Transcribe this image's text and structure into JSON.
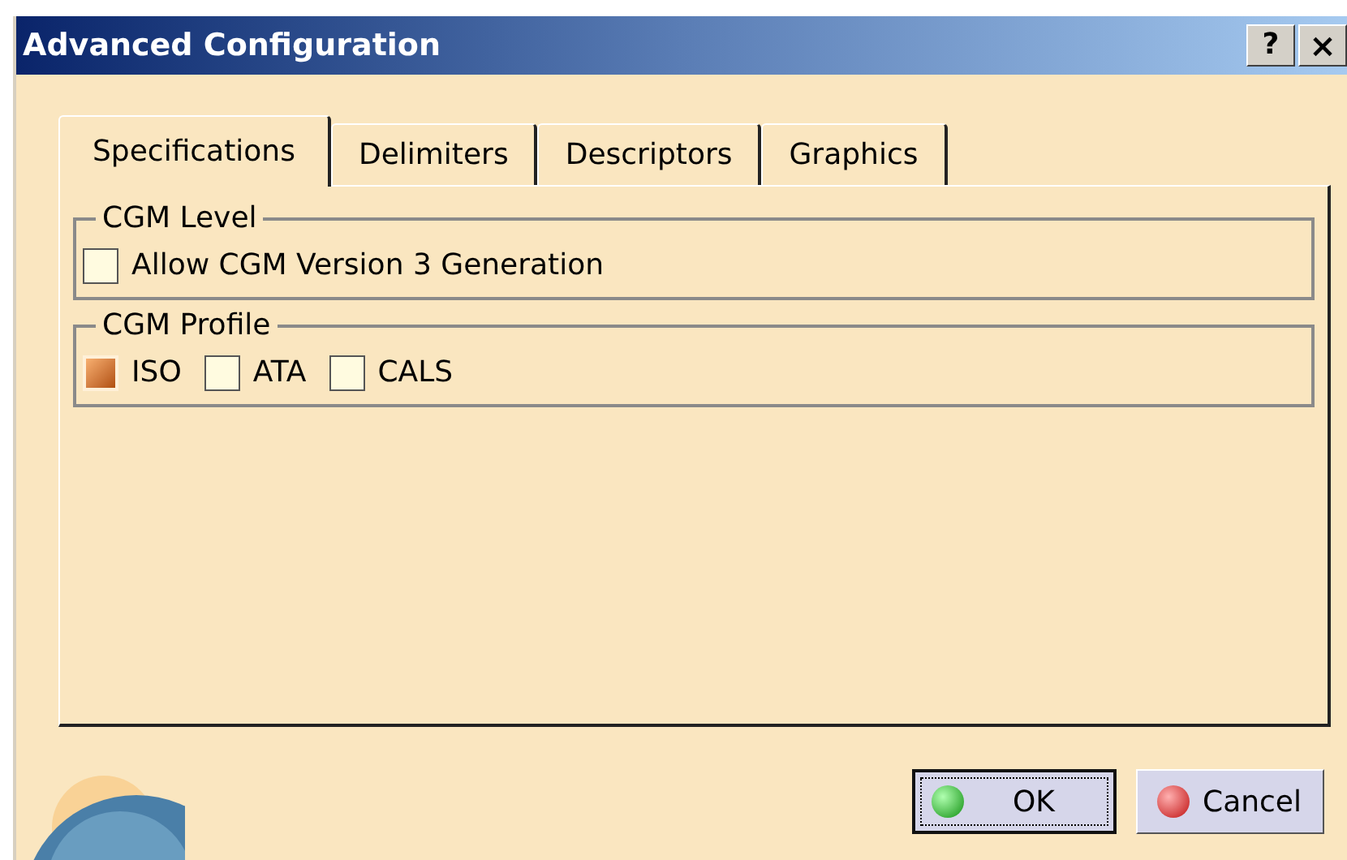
{
  "window": {
    "title": "Advanced Configuration",
    "help_button": "?",
    "close_button": "×"
  },
  "tabs": [
    {
      "label": "Specifications",
      "selected": true
    },
    {
      "label": "Delimiters",
      "selected": false
    },
    {
      "label": "Descriptors",
      "selected": false
    },
    {
      "label": "Graphics",
      "selected": false
    }
  ],
  "groups": [
    {
      "title": "CGM Level",
      "options": [
        {
          "label": "Allow CGM Version 3 Generation",
          "checked": false
        }
      ]
    },
    {
      "title": "CGM Profile",
      "options": [
        {
          "label": "ISO",
          "checked": true
        },
        {
          "label": "ATA",
          "checked": false
        },
        {
          "label": "CALS",
          "checked": false
        }
      ]
    }
  ],
  "buttons": [
    {
      "label": "OK",
      "kind": "ok"
    },
    {
      "label": "Cancel",
      "kind": "cancel"
    }
  ]
}
